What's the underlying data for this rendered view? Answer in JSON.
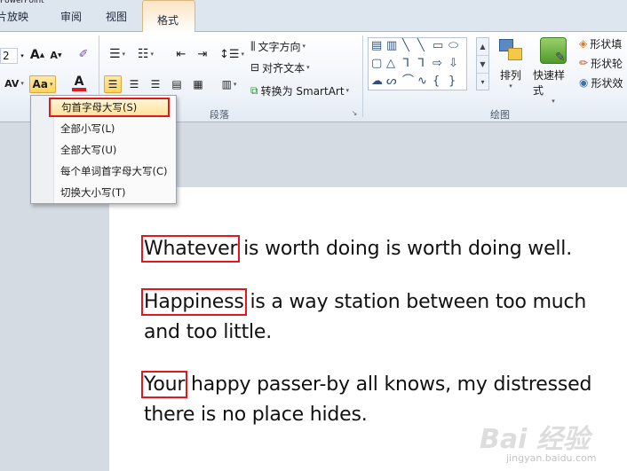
{
  "window": {
    "title_fragment": "PowerPoint"
  },
  "tabs": [
    {
      "label": "片放映"
    },
    {
      "label": "审阅"
    },
    {
      "label": "视图"
    },
    {
      "label": "格式"
    }
  ],
  "ribbon": {
    "font_size_value": "2",
    "paragraph_group_label": "段落",
    "drawing_group_label": "绘图",
    "text_direction_label": "文字方向",
    "align_text_label": "对齐文本",
    "convert_smartart_label": "转换为 SmartArt",
    "arrange_label": "排列",
    "quick_styles_label": "快速样式",
    "shape_fill_label": "形状填",
    "shape_outline_label": "形状轮",
    "shape_effects_label": "形状效",
    "change_case_label": "Aa",
    "font_color_label": "A",
    "grow_font_label": "A",
    "shrink_font_label": "A",
    "char_spacing_label": "AV"
  },
  "change_case_menu": {
    "items": [
      {
        "label": "句首字母大写(S)"
      },
      {
        "label": "全部小写(L)"
      },
      {
        "label": "全部大写(U)"
      },
      {
        "label": "每个单词首字母大写(C)"
      },
      {
        "label": "切换大小写(T)"
      }
    ]
  },
  "document": {
    "paragraphs": [
      {
        "highlight": "Whatever",
        "rest": " is worth doing is worth doing well."
      },
      {
        "highlight": "Happiness",
        "rest": " is a way station between too much and too little."
      },
      {
        "highlight": "Your",
        "rest": " happy passer-by all knows, my distressed there is no place hides."
      }
    ]
  },
  "colors": {
    "highlight_box": "#e0191e",
    "menu_active": "#ffe29a",
    "font_color_red": "#e0191e"
  },
  "watermark": {
    "text": "Bai 经验",
    "sub": "jingyan.baidu.com"
  }
}
